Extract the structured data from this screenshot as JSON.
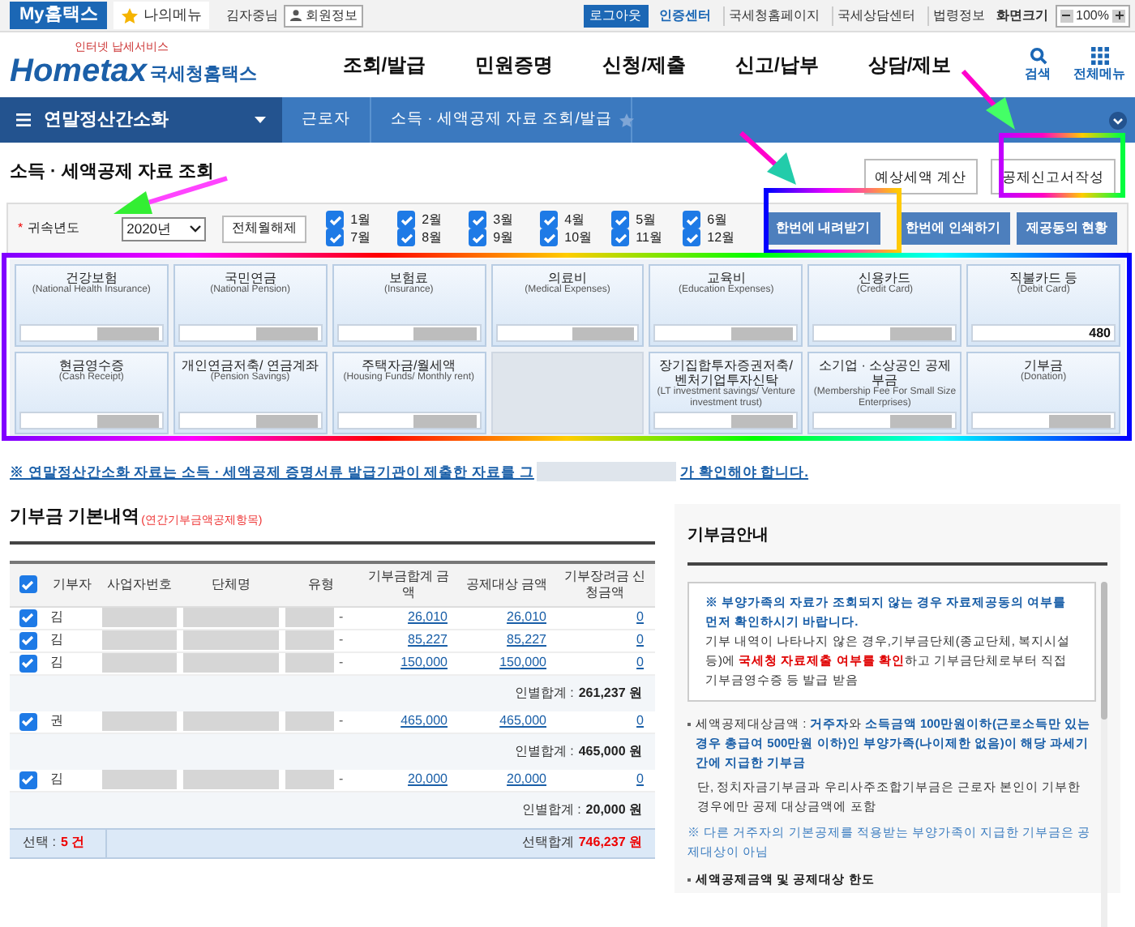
{
  "top_bar": {
    "my_hometax": "My홈택스",
    "my_menu": "나의메뉴",
    "user": "김자중님",
    "member_info": "회원정보",
    "logout": "로그아웃",
    "links": [
      "인증센터",
      "국세청홈페이지",
      "국세상담센터",
      "법령정보"
    ],
    "screen_size_label": "화면크기",
    "zoom": "100%"
  },
  "header": {
    "logo_tagline": "인터넷 납세서비스",
    "logo": "Hometax",
    "logo_suffix": "국세청홈택스",
    "menus": [
      "조회/발급",
      "민원증명",
      "신청/제출",
      "신고/납부",
      "상담/제보"
    ],
    "search": "검색",
    "all_menu": "전체메뉴"
  },
  "nav": {
    "section": "연말정산간소화",
    "crumbs": [
      "근로자",
      "소득 · 세액공제 자료 조회/발급"
    ]
  },
  "page_title": "소득 · 세액공제 자료 조회",
  "top_buttons": [
    "예상세액 계산",
    "공제신고서작성"
  ],
  "filter": {
    "required_mark": "*",
    "label": "귀속년도",
    "year": "2020년",
    "toggle_button": "전체월해제",
    "months": [
      {
        "label": "1월",
        "checked": true
      },
      {
        "label": "2월",
        "checked": true
      },
      {
        "label": "3월",
        "checked": true
      },
      {
        "label": "4월",
        "checked": true
      },
      {
        "label": "5월",
        "checked": true
      },
      {
        "label": "6월",
        "checked": true
      },
      {
        "label": "7월",
        "checked": true
      },
      {
        "label": "8월",
        "checked": true
      },
      {
        "label": "9월",
        "checked": true
      },
      {
        "label": "10월",
        "checked": true
      },
      {
        "label": "11월",
        "checked": true
      },
      {
        "label": "12월",
        "checked": true
      }
    ],
    "buttons": [
      "한번에 내려받기",
      "한번에 인쇄하기",
      "제공동의 현황"
    ]
  },
  "cards": [
    {
      "kind": "card",
      "title": "건강보험",
      "subtitle": "(National Health Insurance)"
    },
    {
      "kind": "card",
      "title": "국민연금",
      "subtitle": "(National Pension)"
    },
    {
      "kind": "card",
      "title": "보험료",
      "subtitle": "(Insurance)"
    },
    {
      "kind": "card",
      "title": "의료비",
      "subtitle": "(Medical Expenses)"
    },
    {
      "kind": "card",
      "title": "교육비",
      "subtitle": "(Education Expenses)"
    },
    {
      "kind": "card",
      "title": "신용카드",
      "subtitle": "(Credit Card)"
    },
    {
      "kind": "card",
      "title": "직불카드 등",
      "subtitle": "(Debit Card)",
      "value": "480"
    },
    {
      "kind": "card",
      "title": "현금영수증",
      "subtitle": "(Cash Receipt)"
    },
    {
      "kind": "card",
      "title": "개인연금저축/ 연금계좌",
      "subtitle": "(Pension Savings)"
    },
    {
      "kind": "card",
      "title": "주택자금/월세액",
      "subtitle": "(Housing Funds/ Monthly rent)"
    },
    {
      "kind": "masked"
    },
    {
      "kind": "card",
      "title": "장기집합투자증권저축/ 벤처기업투자신탁",
      "subtitle": "(LT investment savings/ Venture investment trust)"
    },
    {
      "kind": "card",
      "title": "소기업 · 소상공인 공제부금",
      "subtitle": "(Membership Fee For Small Size Enterprises)"
    },
    {
      "kind": "card",
      "title": "기부금",
      "subtitle": "(Donation)"
    }
  ],
  "notice": {
    "text": "※ 연말정산간소화 자료는 소득 · 세액공제 증명서류 발급기관이 제출한 자료를 그",
    "tail": "가 확인해야 합니다."
  },
  "donation_table": {
    "title": "기부금 기본내역",
    "title_note": "(연간기부금액공제항목)",
    "all_checked": true,
    "columns": [
      "기부자",
      "사업자번호",
      "단체명",
      "유형",
      "기부금합계 금액",
      "공제대상 금액",
      "기부장려금 신청금액"
    ],
    "rows": [
      {
        "kind": "item",
        "checked": true,
        "donor": "김",
        "type": "-",
        "total": "26,010",
        "eligible": "26,010",
        "incentive": "0"
      },
      {
        "kind": "item",
        "checked": true,
        "donor": "김",
        "type": "-",
        "total": "85,227",
        "eligible": "85,227",
        "incentive": "0"
      },
      {
        "kind": "item",
        "checked": true,
        "donor": "김",
        "type": "-",
        "total": "150,000",
        "eligible": "150,000",
        "incentive": "0"
      },
      {
        "kind": "subtotal",
        "label": "인별합계 :",
        "amount": "261,237 원"
      },
      {
        "kind": "item",
        "checked": true,
        "donor": "권",
        "type": "-",
        "total": "465,000",
        "eligible": "465,000",
        "incentive": "0"
      },
      {
        "kind": "subtotal",
        "label": "인별합계 :",
        "amount": "465,000 원"
      },
      {
        "kind": "item",
        "checked": true,
        "donor": "김",
        "type": "-",
        "total": "20,000",
        "eligible": "20,000",
        "incentive": "0"
      },
      {
        "kind": "subtotal",
        "label": "인별합계 :",
        "amount": "20,000 원"
      }
    ],
    "footer": {
      "selected_label": "선택 :",
      "selected_count": "5 건",
      "sum_label": "선택합계",
      "sum": "746,237 원"
    }
  },
  "guide": {
    "title": "기부금안내",
    "box": [
      [
        {
          "kind": "blue",
          "text": "※ 부양가족의 자료가 조회되지 않는 경우 자료제공동의 여부를 먼저 확인하시기 바랍니다."
        }
      ],
      [
        {
          "kind": "plain",
          "text": "기부 내역이 나타나지 않은 경우,기부금단체(종교단체, 복지시설 등)에 "
        },
        {
          "kind": "red",
          "text": "국세청 자료제출 여부를 확인"
        },
        {
          "kind": "plain",
          "text": "하고 기부금단체로부터 직접 기부금영수증 등 발급 받음"
        }
      ]
    ],
    "items": [
      {
        "kind": "bullet",
        "segments": [
          {
            "kind": "plain",
            "text": "세액공제대상금액 : "
          },
          {
            "kind": "blue",
            "text": "거주자"
          },
          {
            "kind": "plain",
            "text": "와 "
          },
          {
            "kind": "blue",
            "text": "소득금액 100만원이하(근로소득만 있는 경우 총급여 500만원 이하)인 부양가족(나이제한 없음)이 해당 과세기간에 지급한 기부금"
          }
        ]
      },
      {
        "kind": "text",
        "segments": [
          {
            "kind": "plain",
            "text": "단, 정치자금기부금과 우리사주조합기부금은 근로자 본인이 기부한 경우에만 공제 대상금액에 포함"
          }
        ]
      },
      {
        "kind": "note",
        "segments": [
          {
            "kind": "note",
            "text": "※ 다른 거주자의 기본공제를 적용받는 부양가족이 지급한 기부금은 공제대상이 아님"
          }
        ]
      },
      {
        "kind": "bullet",
        "segments": [
          {
            "kind": "bold",
            "text": "세액공제금액 및 공제대상 한도"
          }
        ]
      }
    ]
  }
}
